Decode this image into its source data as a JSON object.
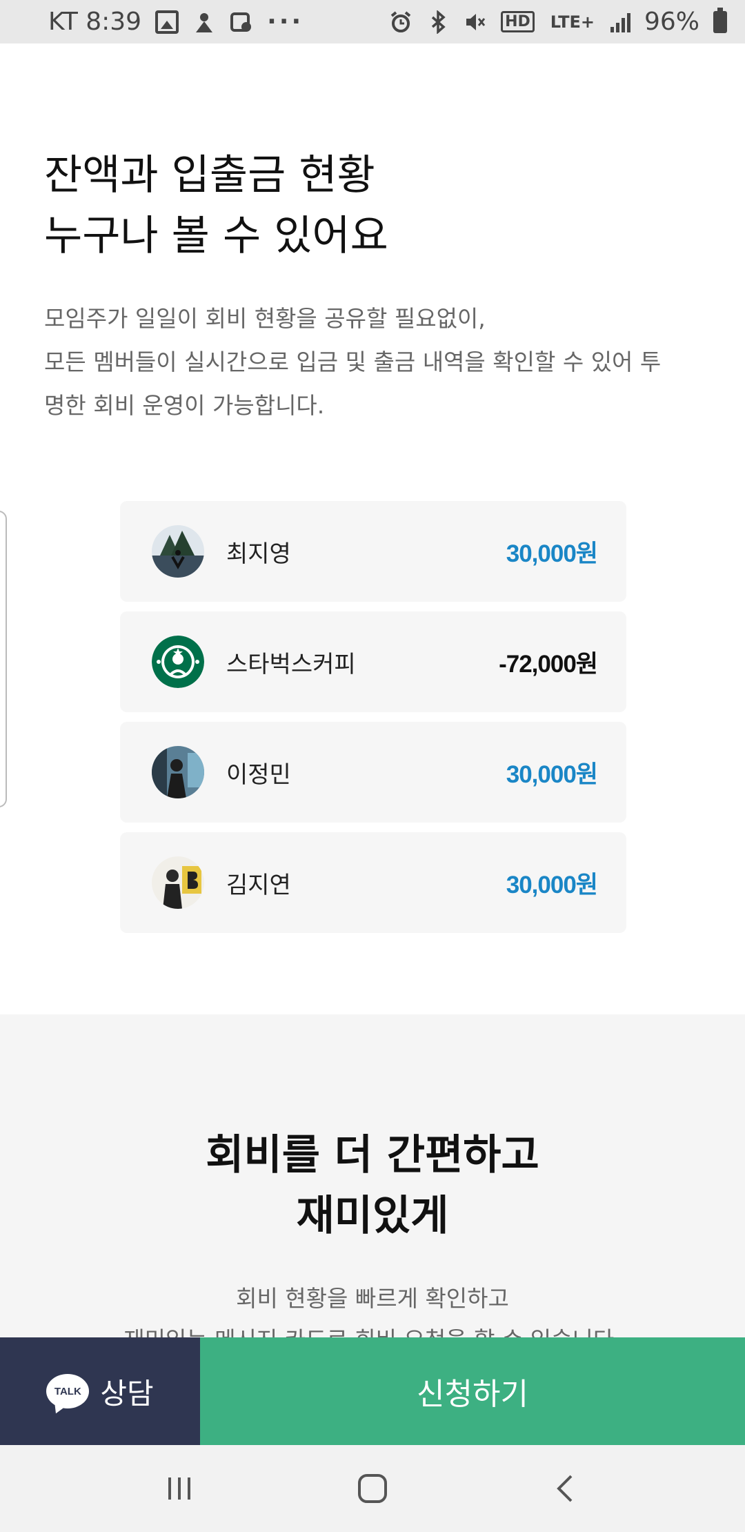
{
  "status_bar": {
    "carrier_time": "KT 8:39",
    "more": "···",
    "hd": "HD",
    "lte": "LTE+",
    "battery": "96%"
  },
  "hero": {
    "title": "잔액과 입출금 현황\n누구나 볼 수 있어요",
    "description": "모임주가 일일이 회비 현황을 공유할 필요없이,\n모든 멤버들이 실시간으로 입금 및 출금 내역을 확인할 수 있어 투\n명한 회비 운영이 가능합니다."
  },
  "transactions": [
    {
      "name": "최지영",
      "amount": "30,000원",
      "direction": "in",
      "avatar": "landscape-photo-avatar"
    },
    {
      "name": "스타벅스커피",
      "amount": "-72,000원",
      "direction": "out",
      "avatar": "starbucks-logo"
    },
    {
      "name": "이정민",
      "amount": "30,000원",
      "direction": "in",
      "avatar": "person-photo-avatar"
    },
    {
      "name": "김지연",
      "amount": "30,000원",
      "direction": "in",
      "avatar": "person-photo-avatar"
    }
  ],
  "section2": {
    "title": "회비를 더 간편하고\n재미있게",
    "description": "회비 현황을 빠르게 확인하고\n재미있는 메시지 카드로 회비 요청을 할 수 있습니다."
  },
  "cta": {
    "talk_icon_text": "TALK",
    "talk_label": "상담",
    "apply_label": "신청하기"
  },
  "colors": {
    "income": "#1a86c6",
    "talk_bg": "#2f3651",
    "apply_bg": "#3db082"
  }
}
